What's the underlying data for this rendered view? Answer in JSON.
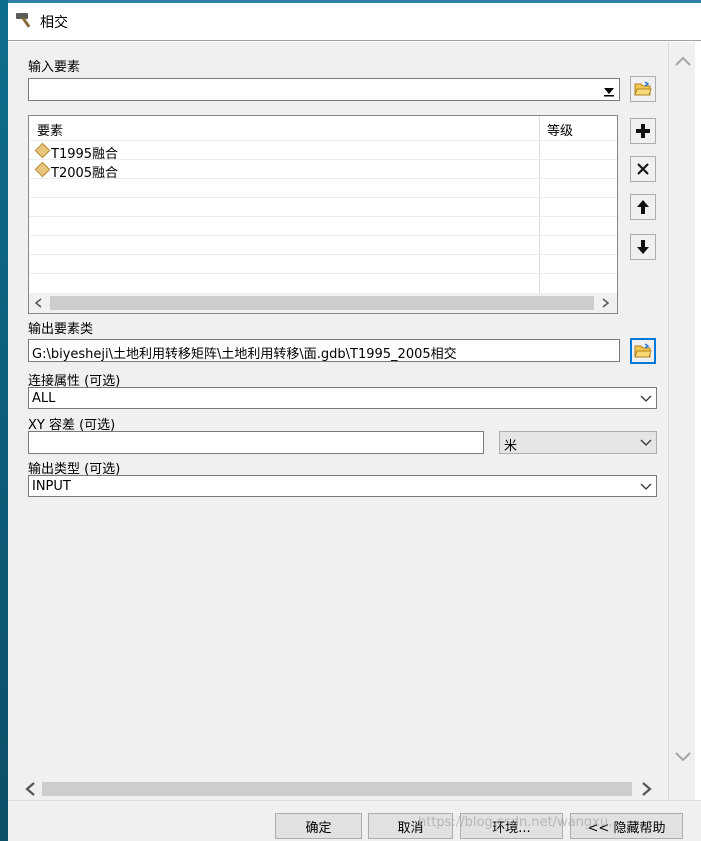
{
  "window": {
    "title": "相交"
  },
  "input_features": {
    "label": "输入要素",
    "value": "",
    "table": {
      "headers": [
        "要素",
        "等级"
      ],
      "rows": [
        {
          "name": "T1995融合",
          "rank": ""
        },
        {
          "name": "T2005融合",
          "rank": ""
        }
      ]
    }
  },
  "output": {
    "label": "输出要素类",
    "value": "G:\\biyesheji\\土地利用转移矩阵\\土地利用转移\\面.gdb\\T1995_2005相交"
  },
  "join_attributes": {
    "label": "连接属性 (可选)",
    "value": "ALL"
  },
  "xy_tolerance": {
    "label": "XY 容差 (可选)",
    "value": "",
    "unit": "米"
  },
  "output_type": {
    "label": "输出类型 (可选)",
    "value": "INPUT"
  },
  "buttons": {
    "ok": "确定",
    "cancel": "取消",
    "environments": "环境...",
    "hide_help": "<< 隐藏帮助"
  },
  "icons": {
    "title": "hammer-icon",
    "browse": "folder-open-icon",
    "add": "plus-icon",
    "remove": "x-icon",
    "up": "arrow-up-icon",
    "down": "arrow-down-icon"
  },
  "watermark": "https://blog.csdn.net/wangxu..."
}
